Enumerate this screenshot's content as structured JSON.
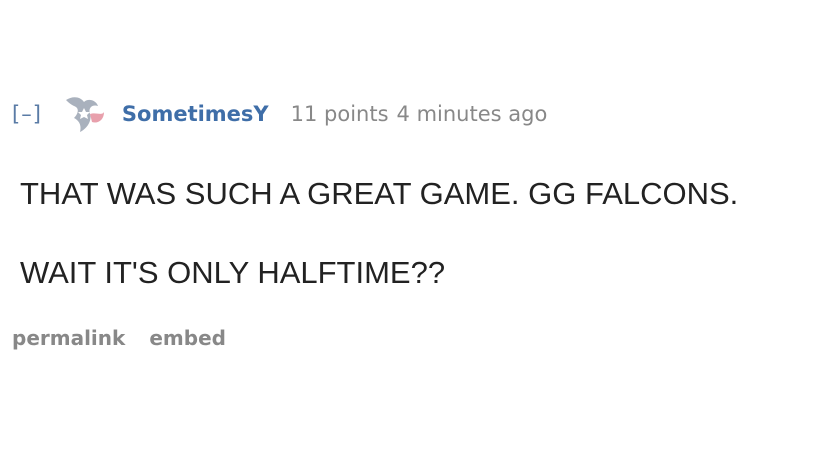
{
  "comment": {
    "collapse_label": "[–]",
    "author": "SometimesY",
    "score": "11 points",
    "time": "4 minutes ago",
    "flair_icon": "houston-texans-icon",
    "body": [
      "THAT WAS SUCH A GREAT GAME. GG FALCONS.",
      "WAIT IT'S ONLY HALFTIME??"
    ],
    "buttons": {
      "permalink": "permalink",
      "embed": "embed"
    }
  },
  "colors": {
    "author": "#3f6ea8",
    "meta": "#888888",
    "body_text": "#222222",
    "flair_navy": "#a0a8b4",
    "flair_red": "#e8a0ac"
  }
}
